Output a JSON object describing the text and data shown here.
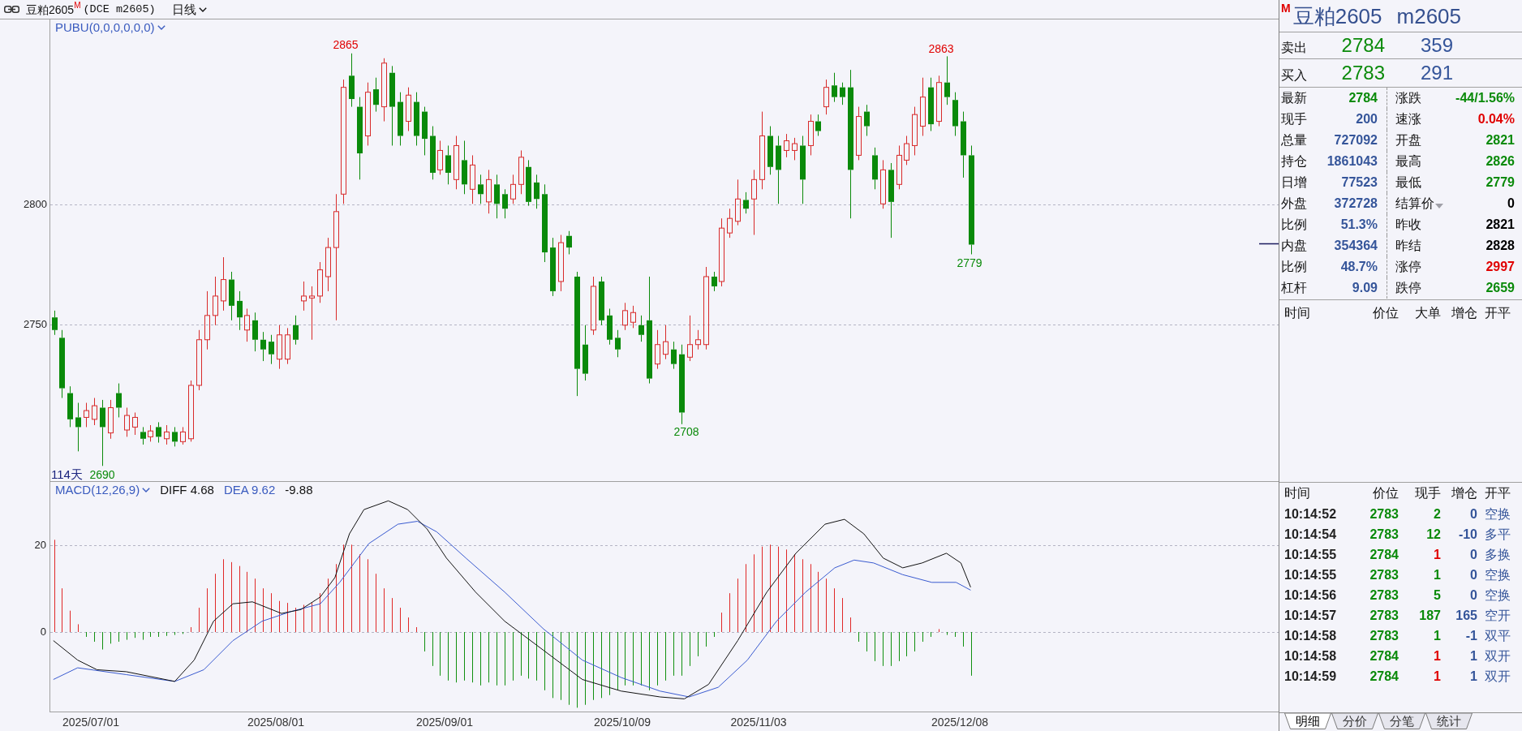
{
  "title_bar": {
    "instrument": "豆粕2605",
    "market_mark": "M",
    "code": "(DCE m2605)",
    "period": "日线"
  },
  "price_chart": {
    "indicator": "PUBU(0,0,0,0,0,0)",
    "y_ticks": [
      "2800",
      "2750"
    ],
    "extreme_labels": [
      {
        "text": "2865",
        "kind": "high"
      },
      {
        "text": "2863",
        "kind": "high"
      },
      {
        "text": "2779",
        "kind": "low"
      },
      {
        "text": "2708",
        "kind": "low"
      },
      {
        "text": "2690",
        "kind": "low"
      }
    ],
    "day_count": "114天"
  },
  "macd_chart": {
    "indicator": "MACD(12,26,9)",
    "readings": [
      {
        "text": "DIFF 4.68",
        "kind": "diff"
      },
      {
        "text": "DEA 9.62",
        "kind": "dea"
      },
      {
        "text": "-9.88",
        "kind": "macd"
      }
    ],
    "y_ticks": [
      "20",
      "0"
    ]
  },
  "x_axis": {
    "labels": [
      "2025/07/01",
      "2025/08/01",
      "2025/09/01",
      "2025/10/09",
      "2025/11/03",
      "2025/12/08"
    ]
  },
  "quote_panel": {
    "market_mark": "M",
    "name": "豆粕2605",
    "code": "m2605",
    "ask": {
      "label": "卖出",
      "price": "2784",
      "volume": "359"
    },
    "bid": {
      "label": "买入",
      "price": "2783",
      "volume": "291"
    },
    "stats": [
      {
        "left": {
          "label": "最新",
          "value": "2784",
          "color": "#0a8a0a"
        },
        "right": {
          "label": "涨跌",
          "value": "-44/1.56%",
          "color": "#0a8a0a"
        }
      },
      {
        "left": {
          "label": "现手",
          "value": "200",
          "color": "#35559a"
        },
        "right": {
          "label": "速涨",
          "value": "0.04%",
          "color": "#e00000"
        }
      },
      {
        "left": {
          "label": "总量",
          "value": "727092",
          "color": "#35559a"
        },
        "right": {
          "label": "开盘",
          "value": "2821",
          "color": "#0a8a0a"
        }
      },
      {
        "left": {
          "label": "持仓",
          "value": "1861043",
          "color": "#35559a"
        },
        "right": {
          "label": "最高",
          "value": "2826",
          "color": "#0a8a0a"
        }
      },
      {
        "left": {
          "label": "日增",
          "value": "77523",
          "color": "#35559a"
        },
        "right": {
          "label": "最低",
          "value": "2779",
          "color": "#0a8a0a"
        }
      },
      {
        "left": {
          "label": "外盘",
          "value": "372728",
          "color": "#35559a"
        },
        "right": {
          "label": "结算价",
          "value": "0",
          "color": "#000000",
          "dropdown": true
        }
      },
      {
        "left": {
          "label": "比例",
          "value": "51.3%",
          "color": "#35559a"
        },
        "right": {
          "label": "昨收",
          "value": "2821",
          "color": "#000000"
        }
      },
      {
        "left": {
          "label": "内盘",
          "value": "354364",
          "color": "#35559a"
        },
        "right": {
          "label": "昨结",
          "value": "2828",
          "color": "#000000"
        }
      },
      {
        "left": {
          "label": "比例",
          "value": "48.7%",
          "color": "#35559a"
        },
        "right": {
          "label": "涨停",
          "value": "2997",
          "color": "#e00000"
        }
      },
      {
        "left": {
          "label": "杠杆",
          "value": "9.09",
          "color": "#35559a"
        },
        "right": {
          "label": "跌停",
          "value": "2659",
          "color": "#0a8a0a"
        }
      }
    ]
  },
  "big_orders": {
    "columns": [
      "时间",
      "价位",
      "大单",
      "增仓",
      "开平"
    ]
  },
  "trades": {
    "columns": [
      "时间",
      "价位",
      "现手",
      "增仓",
      "开平"
    ],
    "rows": [
      {
        "time": "10:14:52",
        "price": "2783",
        "volume": "2",
        "color": "#0a8a0a",
        "change": "0",
        "type": "空换"
      },
      {
        "time": "10:14:54",
        "price": "2783",
        "volume": "12",
        "color": "#0a8a0a",
        "change": "-10",
        "type": "多平"
      },
      {
        "time": "10:14:55",
        "price": "2784",
        "volume": "1",
        "color": "#e00000",
        "change": "0",
        "type": "多换"
      },
      {
        "time": "10:14:55",
        "price": "2783",
        "volume": "1",
        "color": "#0a8a0a",
        "change": "0",
        "type": "空换"
      },
      {
        "time": "10:14:56",
        "price": "2783",
        "volume": "5",
        "color": "#0a8a0a",
        "change": "0",
        "type": "空换"
      },
      {
        "time": "10:14:57",
        "price": "2783",
        "volume": "187",
        "color": "#0a8a0a",
        "change": "165",
        "type": "空开"
      },
      {
        "time": "10:14:58",
        "price": "2783",
        "volume": "1",
        "color": "#0a8a0a",
        "change": "-1",
        "type": "双平"
      },
      {
        "time": "10:14:58",
        "price": "2784",
        "volume": "1",
        "color": "#e00000",
        "change": "1",
        "type": "双开"
      },
      {
        "time": "10:14:59",
        "price": "2784",
        "volume": "1",
        "color": "#e00000",
        "change": "1",
        "type": "双开"
      }
    ]
  },
  "tabs": [
    {
      "label": "明细",
      "selected": true
    },
    {
      "label": "分价",
      "selected": false
    },
    {
      "label": "分笔",
      "selected": false
    },
    {
      "label": "统计",
      "selected": false
    }
  ]
}
